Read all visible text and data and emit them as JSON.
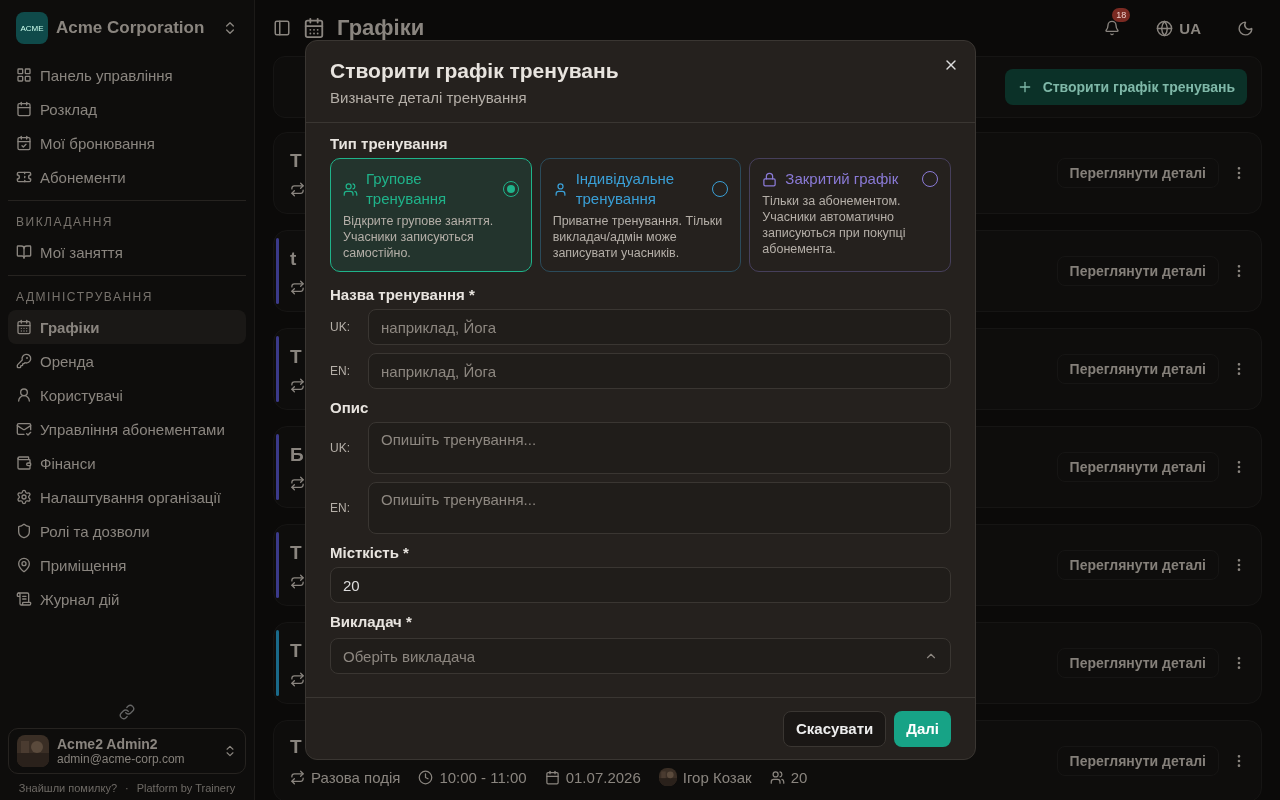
{
  "sidebar": {
    "org": {
      "logo": "ACME",
      "name": "Acme Corporation"
    },
    "sections": [
      {
        "items": [
          {
            "label": "Панель управління",
            "selected": false
          },
          {
            "label": "Розклад",
            "selected": false
          },
          {
            "label": "Мої бронювання",
            "selected": false
          },
          {
            "label": "Абонементи",
            "selected": false
          }
        ]
      },
      {
        "title": "ВИКЛАДАННЯ",
        "items": [
          {
            "label": "Мої заняття",
            "selected": false
          }
        ]
      },
      {
        "title": "АДМІНІСТРУВАННЯ",
        "items": [
          {
            "label": "Графіки",
            "selected": true
          },
          {
            "label": "Оренда",
            "selected": false
          },
          {
            "label": "Користувачі",
            "selected": false
          },
          {
            "label": "Управління абонементами",
            "selected": false
          },
          {
            "label": "Фінанси",
            "selected": false
          },
          {
            "label": "Налаштування організації",
            "selected": false
          },
          {
            "label": "Ролі та дозволи",
            "selected": false
          },
          {
            "label": "Приміщення",
            "selected": false
          },
          {
            "label": "Журнал дій",
            "selected": false
          }
        ]
      }
    ],
    "user": {
      "name": "Acme2 Admin2",
      "email": "admin@acme-corp.com"
    },
    "footer_links": [
      "Знайшли помилку?",
      "·",
      "Platform by Trainery"
    ]
  },
  "header": {
    "title": "Графіки",
    "notifications": "18",
    "language": "UA"
  },
  "toolbar": {
    "create_button": "Створити графік тренувань"
  },
  "cards": [
    {
      "title": "Т",
      "action": "Переглянути деталі"
    },
    {
      "title": "t",
      "color": "#3b3a8a",
      "action": "Переглянути деталі"
    },
    {
      "title": "Т",
      "color": "#3b3a8a",
      "action": "Переглянути деталі"
    },
    {
      "title": "Б",
      "color": "#3b3a8a",
      "action": "Переглянути деталі"
    },
    {
      "title": "Т",
      "color": "#3b3a8a",
      "action": "Переглянути деталі"
    },
    {
      "title": "Т",
      "color": "#1a6a8a",
      "action": "Переглянути деталі"
    },
    {
      "title": "Т",
      "action": "Переглянути деталі",
      "meta": {
        "type": "Разова подія",
        "time": "10:00 - 11:00",
        "date": "01.07.2026",
        "instructor": "Ігор Козак",
        "capacity": "20"
      }
    }
  ],
  "modal": {
    "title": "Створити графік тренувань",
    "subtitle": "Визначте деталі тренування",
    "type_label": "Тип тренування",
    "types": [
      {
        "kind": "group",
        "title": "Групове тренування",
        "description": "Відкрите групове заняття. Учасники записуються самостійно.",
        "color": "#1fb38a",
        "selected": true
      },
      {
        "kind": "individual",
        "title": "Індивідуальне тренування",
        "description": "Приватне тренування. Тільки викладач/адмін може записувати учасників.",
        "color": "#3a9fd6",
        "selected": false
      },
      {
        "kind": "closed",
        "title": "Закритий графік",
        "description": "Тільки за абонементом. Учасники автоматично записуються при покупці абонемента.",
        "color": "#8a7ad6",
        "selected": false
      }
    ],
    "name": {
      "label": "Назва тренування *",
      "rows": [
        {
          "lang": "UK:",
          "placeholder": "наприклад, Йога"
        },
        {
          "lang": "EN:",
          "placeholder": "наприклад, Йога"
        }
      ]
    },
    "description": {
      "label": "Опис",
      "rows": [
        {
          "lang": "UK:",
          "placeholder": "Опишіть тренування..."
        },
        {
          "lang": "EN:",
          "placeholder": "Опишіть тренування..."
        }
      ]
    },
    "capacity": {
      "label": "Місткість *",
      "value": "20"
    },
    "instructor": {
      "label": "Викладач *",
      "placeholder": "Оберіть викладача"
    },
    "cancel": "Скасувати",
    "next": "Далі"
  }
}
